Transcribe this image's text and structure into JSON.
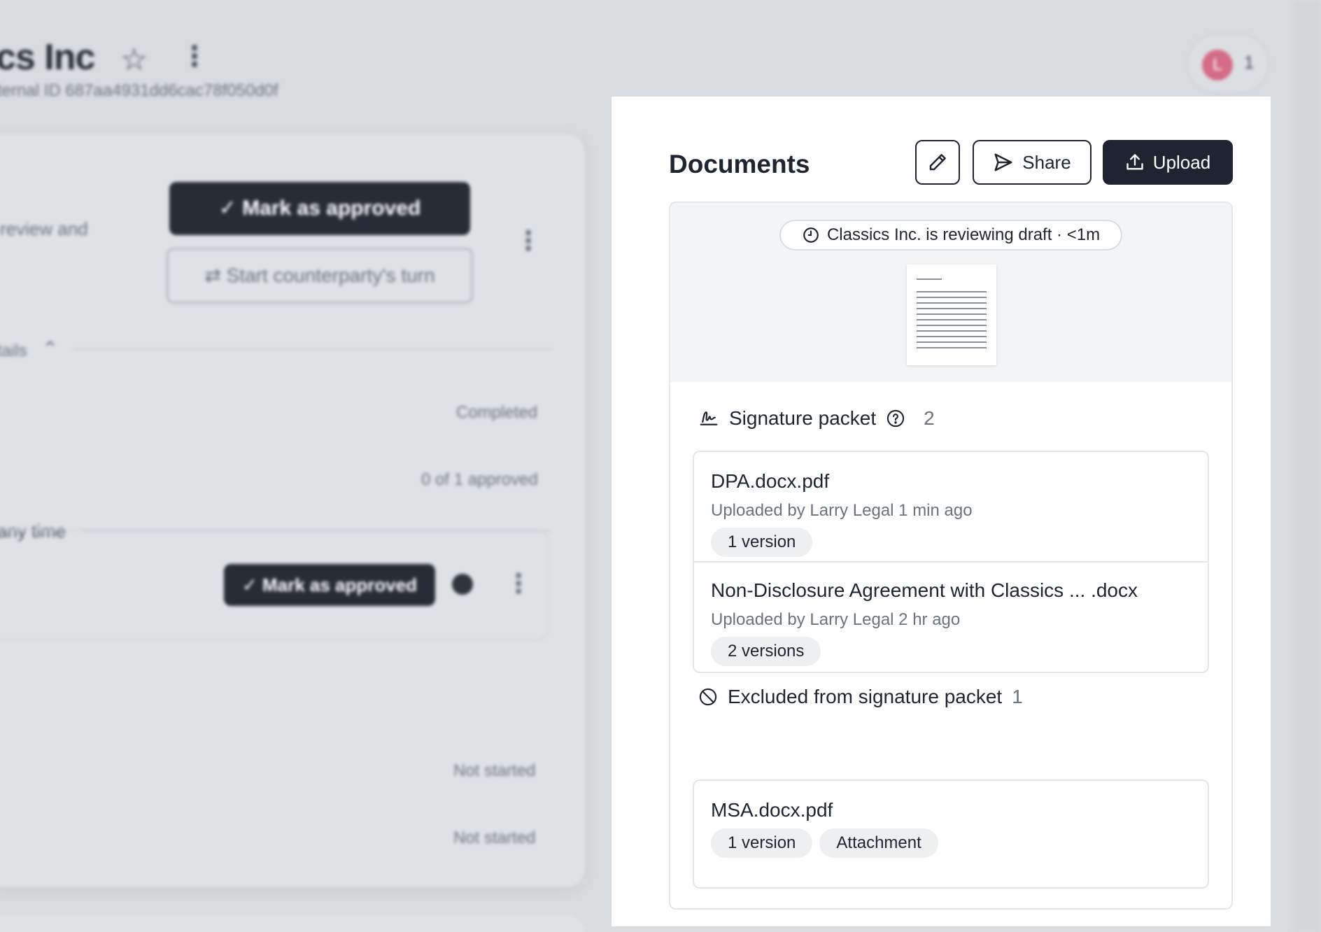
{
  "background": {
    "title": "cs Inc",
    "subtitle": "ternal ID 687aa4931dd6cac78f050d0f",
    "avatar_initial": "L",
    "avatar_count": "1",
    "mark_approved_label": "Mark as approved",
    "counterparty_label": "Start counterparty's turn",
    "review_text": "review and",
    "details_label": "tails",
    "completed_text": "Completed",
    "approved_count_text": "0 of 1 approved",
    "any_time_label": "any time",
    "mark_approved_small_label": "Mark as approved",
    "not_started_1": "Not started",
    "not_started_2": "Not started"
  },
  "panel": {
    "title": "Documents",
    "share_label": "Share",
    "upload_label": "Upload",
    "status": "Classics Inc. is reviewing draft · <1m",
    "signature_packet": {
      "label": "Signature packet",
      "count": "2",
      "documents": [
        {
          "name": "DPA.docx.pdf",
          "meta": "Uploaded by Larry Legal 1 min ago",
          "chips": [
            "1 version"
          ]
        },
        {
          "name": "Non-Disclosure Agreement with Classics ... .docx",
          "meta": "Uploaded by Larry Legal 2 hr ago",
          "chips": [
            "2 versions"
          ]
        }
      ]
    },
    "excluded": {
      "label": "Excluded from signature packet",
      "count": "1",
      "documents": [
        {
          "name": "MSA.docx.pdf",
          "chips": [
            "1 version",
            "Attachment"
          ]
        }
      ]
    }
  }
}
